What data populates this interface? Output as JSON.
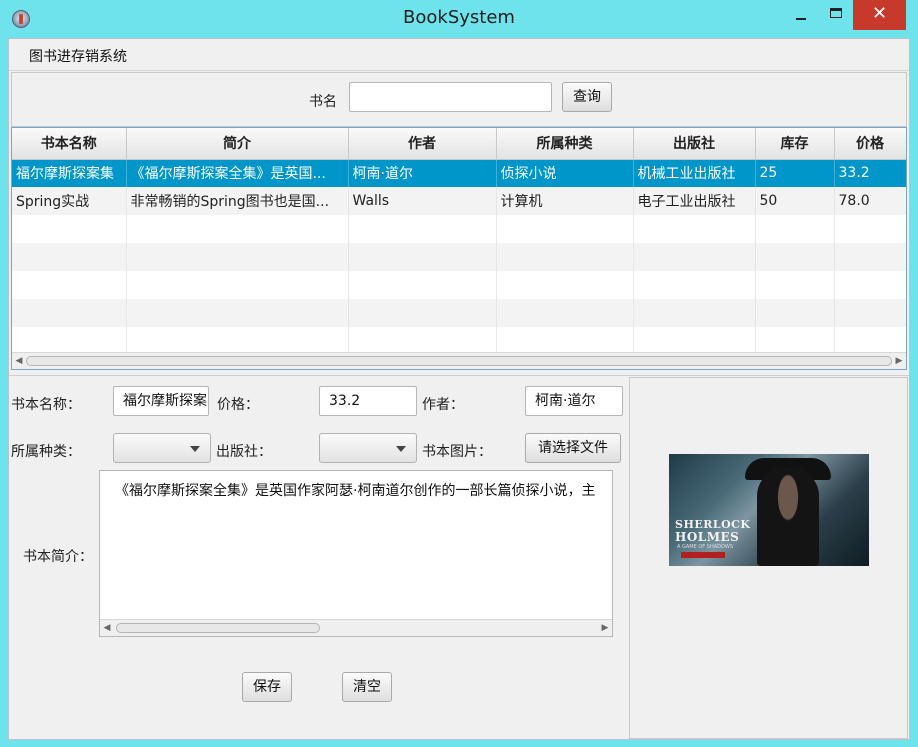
{
  "window": {
    "title": "BookSystem",
    "minimize_glyph": "",
    "close_glyph": "✕"
  },
  "menu": {
    "items": [
      "图书进存销系统"
    ]
  },
  "search": {
    "label": "书名",
    "value": "",
    "button": "查询"
  },
  "table": {
    "headers": [
      "书本名称",
      "简介",
      "作者",
      "所属种类",
      "出版社",
      "库存",
      "价格"
    ],
    "rows": [
      [
        "福尔摩斯探案集",
        "《福尔摩斯探案全集》是英国...",
        "柯南·道尔",
        "侦探小说",
        "机械工业出版社",
        "25",
        "33.2"
      ],
      [
        "Spring实战",
        "非常畅销的Spring图书也是国...",
        "Walls",
        "计算机",
        "电子工业出版社",
        "50",
        "78.0"
      ]
    ],
    "selected_row": 0,
    "empty_rows": 5
  },
  "form": {
    "name_label": "书本名称：",
    "name_value": "福尔摩斯探案",
    "price_label": "价格：",
    "price_value": "33.2",
    "author_label": "作者：",
    "author_value": "柯南·道尔",
    "category_label": "所属种类：",
    "category_value": "",
    "publisher_label": "出版社：",
    "publisher_value": "",
    "image_label": "书本图片：",
    "choose_file_button": "请选择文件",
    "intro_label": "书本简介：",
    "intro_value": "《福尔摩斯探案全集》是英国作家阿瑟·柯南道尔创作的一部长篇侦探小说，主",
    "save_button": "保存",
    "clear_button": "清空"
  },
  "image": {
    "logo_line1": "SHERLOCK",
    "logo_line2": "HOLMES",
    "logo_line3": "A GAME OF SHADOWS"
  },
  "colors": {
    "title_bar": "#6ee3ec",
    "selection": "#0096c9",
    "close_button": "#c7392b"
  }
}
